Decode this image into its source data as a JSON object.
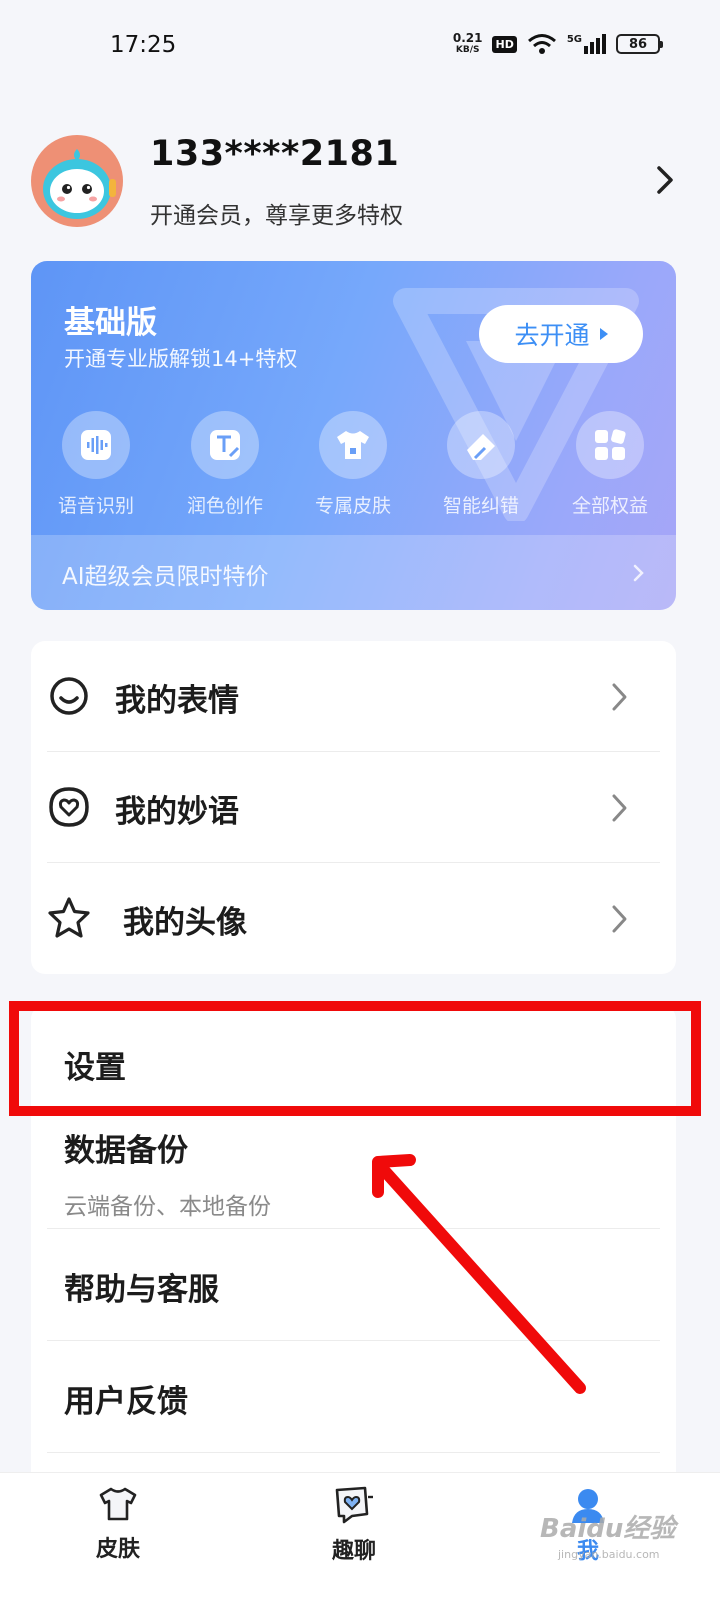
{
  "status_bar": {
    "time": "17:25",
    "net_speed_value": "0.21",
    "net_speed_unit": "KB/S",
    "hd": "HD",
    "signal": "5G",
    "battery": "86"
  },
  "profile": {
    "username": "133****2181",
    "subtitle": "开通会员，尊享更多特权"
  },
  "vip_card": {
    "title": "基础版",
    "subtitle": "开通专业版解锁14+特权",
    "open_button": "去开通",
    "features": [
      {
        "label": "语音识别",
        "icon": "voice-wave-icon"
      },
      {
        "label": "润色创作",
        "icon": "text-edit-icon"
      },
      {
        "label": "专属皮肤",
        "icon": "tshirt-icon"
      },
      {
        "label": "智能纠错",
        "icon": "eraser-icon"
      },
      {
        "label": "全部权益",
        "icon": "grid-icon"
      }
    ],
    "promo": "AI超级会员限时特价"
  },
  "my_list": [
    {
      "label": "我的表情",
      "icon": "smiley-icon"
    },
    {
      "label": "我的妙语",
      "icon": "heart-bubble-icon"
    },
    {
      "label": "我的头像",
      "icon": "star-icon"
    }
  ],
  "settings_list": {
    "settings": "设置",
    "backup": "数据备份",
    "backup_sub": "云端备份、本地备份",
    "help": "帮助与客服",
    "feedback": "用户反馈"
  },
  "tab_bar": {
    "tabs": [
      {
        "label": "皮肤",
        "icon": "tshirt-icon"
      },
      {
        "label": "趣聊",
        "icon": "chat-heart-icon"
      },
      {
        "label": "我",
        "icon": "profile-icon",
        "active": true
      }
    ]
  },
  "watermark": {
    "text": "Baidu经验",
    "sub": "jingyan.baidu.com"
  },
  "colors": {
    "accent": "#3b8af0",
    "vip_gradient_start": "#5e95f6",
    "vip_gradient_end": "#a7a6f7",
    "annotation_red": "#f00a0a"
  }
}
